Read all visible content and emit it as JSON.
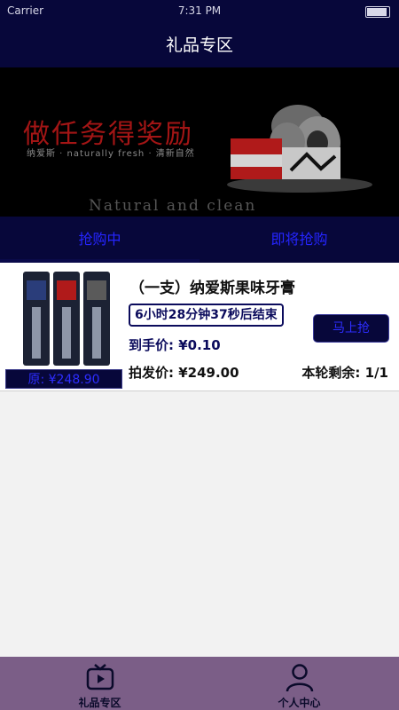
{
  "status_bar": {
    "carrier": "Carrier",
    "time": "7:31 PM"
  },
  "nav": {
    "title": "礼品专区"
  },
  "banner": {
    "headline": "做任务得奖励",
    "subtext": "纳爱斯 · naturally fresh · 清新自然",
    "footer_text": "Natural and clean"
  },
  "tabs": [
    {
      "label": "抢购中",
      "active": true
    },
    {
      "label": "即将抢购",
      "active": false
    }
  ],
  "product": {
    "title": "（一支）纳爱斯果味牙膏",
    "countdown": "6小时28分钟37秒后结束",
    "buy_label": "马上抢",
    "final_price": "到手价: ¥0.10",
    "auction_price": "拍发价: ¥249.00",
    "remaining": "本轮剩余: 1/1",
    "original_price": "原: ¥248.90"
  },
  "tabbar": [
    {
      "label": "礼品专区",
      "icon": "tv-play-icon",
      "active": true
    },
    {
      "label": "个人中心",
      "icon": "person-icon",
      "active": false
    }
  ],
  "colors": {
    "nav_bg": "#07073a",
    "accent_blue": "#2d2dff",
    "tabbar_bg": "#7b5e87",
    "banner_red": "#a31515"
  }
}
